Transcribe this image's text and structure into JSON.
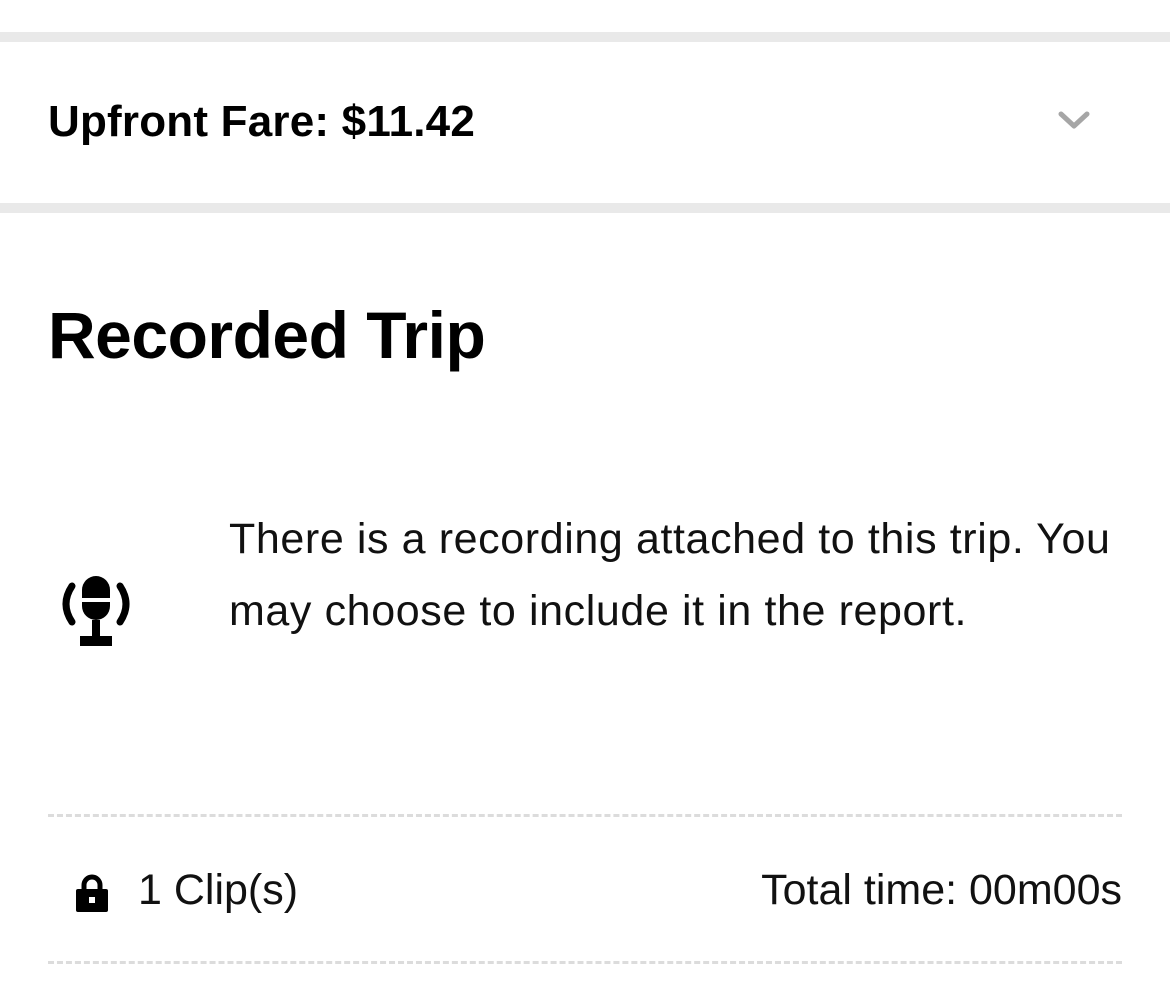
{
  "fare": {
    "label": "Upfront Fare: $11.42",
    "chevron_icon": "chevron-down-icon"
  },
  "recording": {
    "title": "Recorded Trip",
    "icon": "microphone-recording-icon",
    "message": "There is a recording attached to this trip. You may choose to include it in the report."
  },
  "clips": {
    "lock_icon": "lock-icon",
    "count_label": "1 Clip(s)",
    "total_time_label": "Total time: 00m00s"
  },
  "colors": {
    "divider": "#e9e9e9",
    "dashed": "#dcdcdc",
    "chevron": "#a6a6a6",
    "text": "#000000"
  }
}
